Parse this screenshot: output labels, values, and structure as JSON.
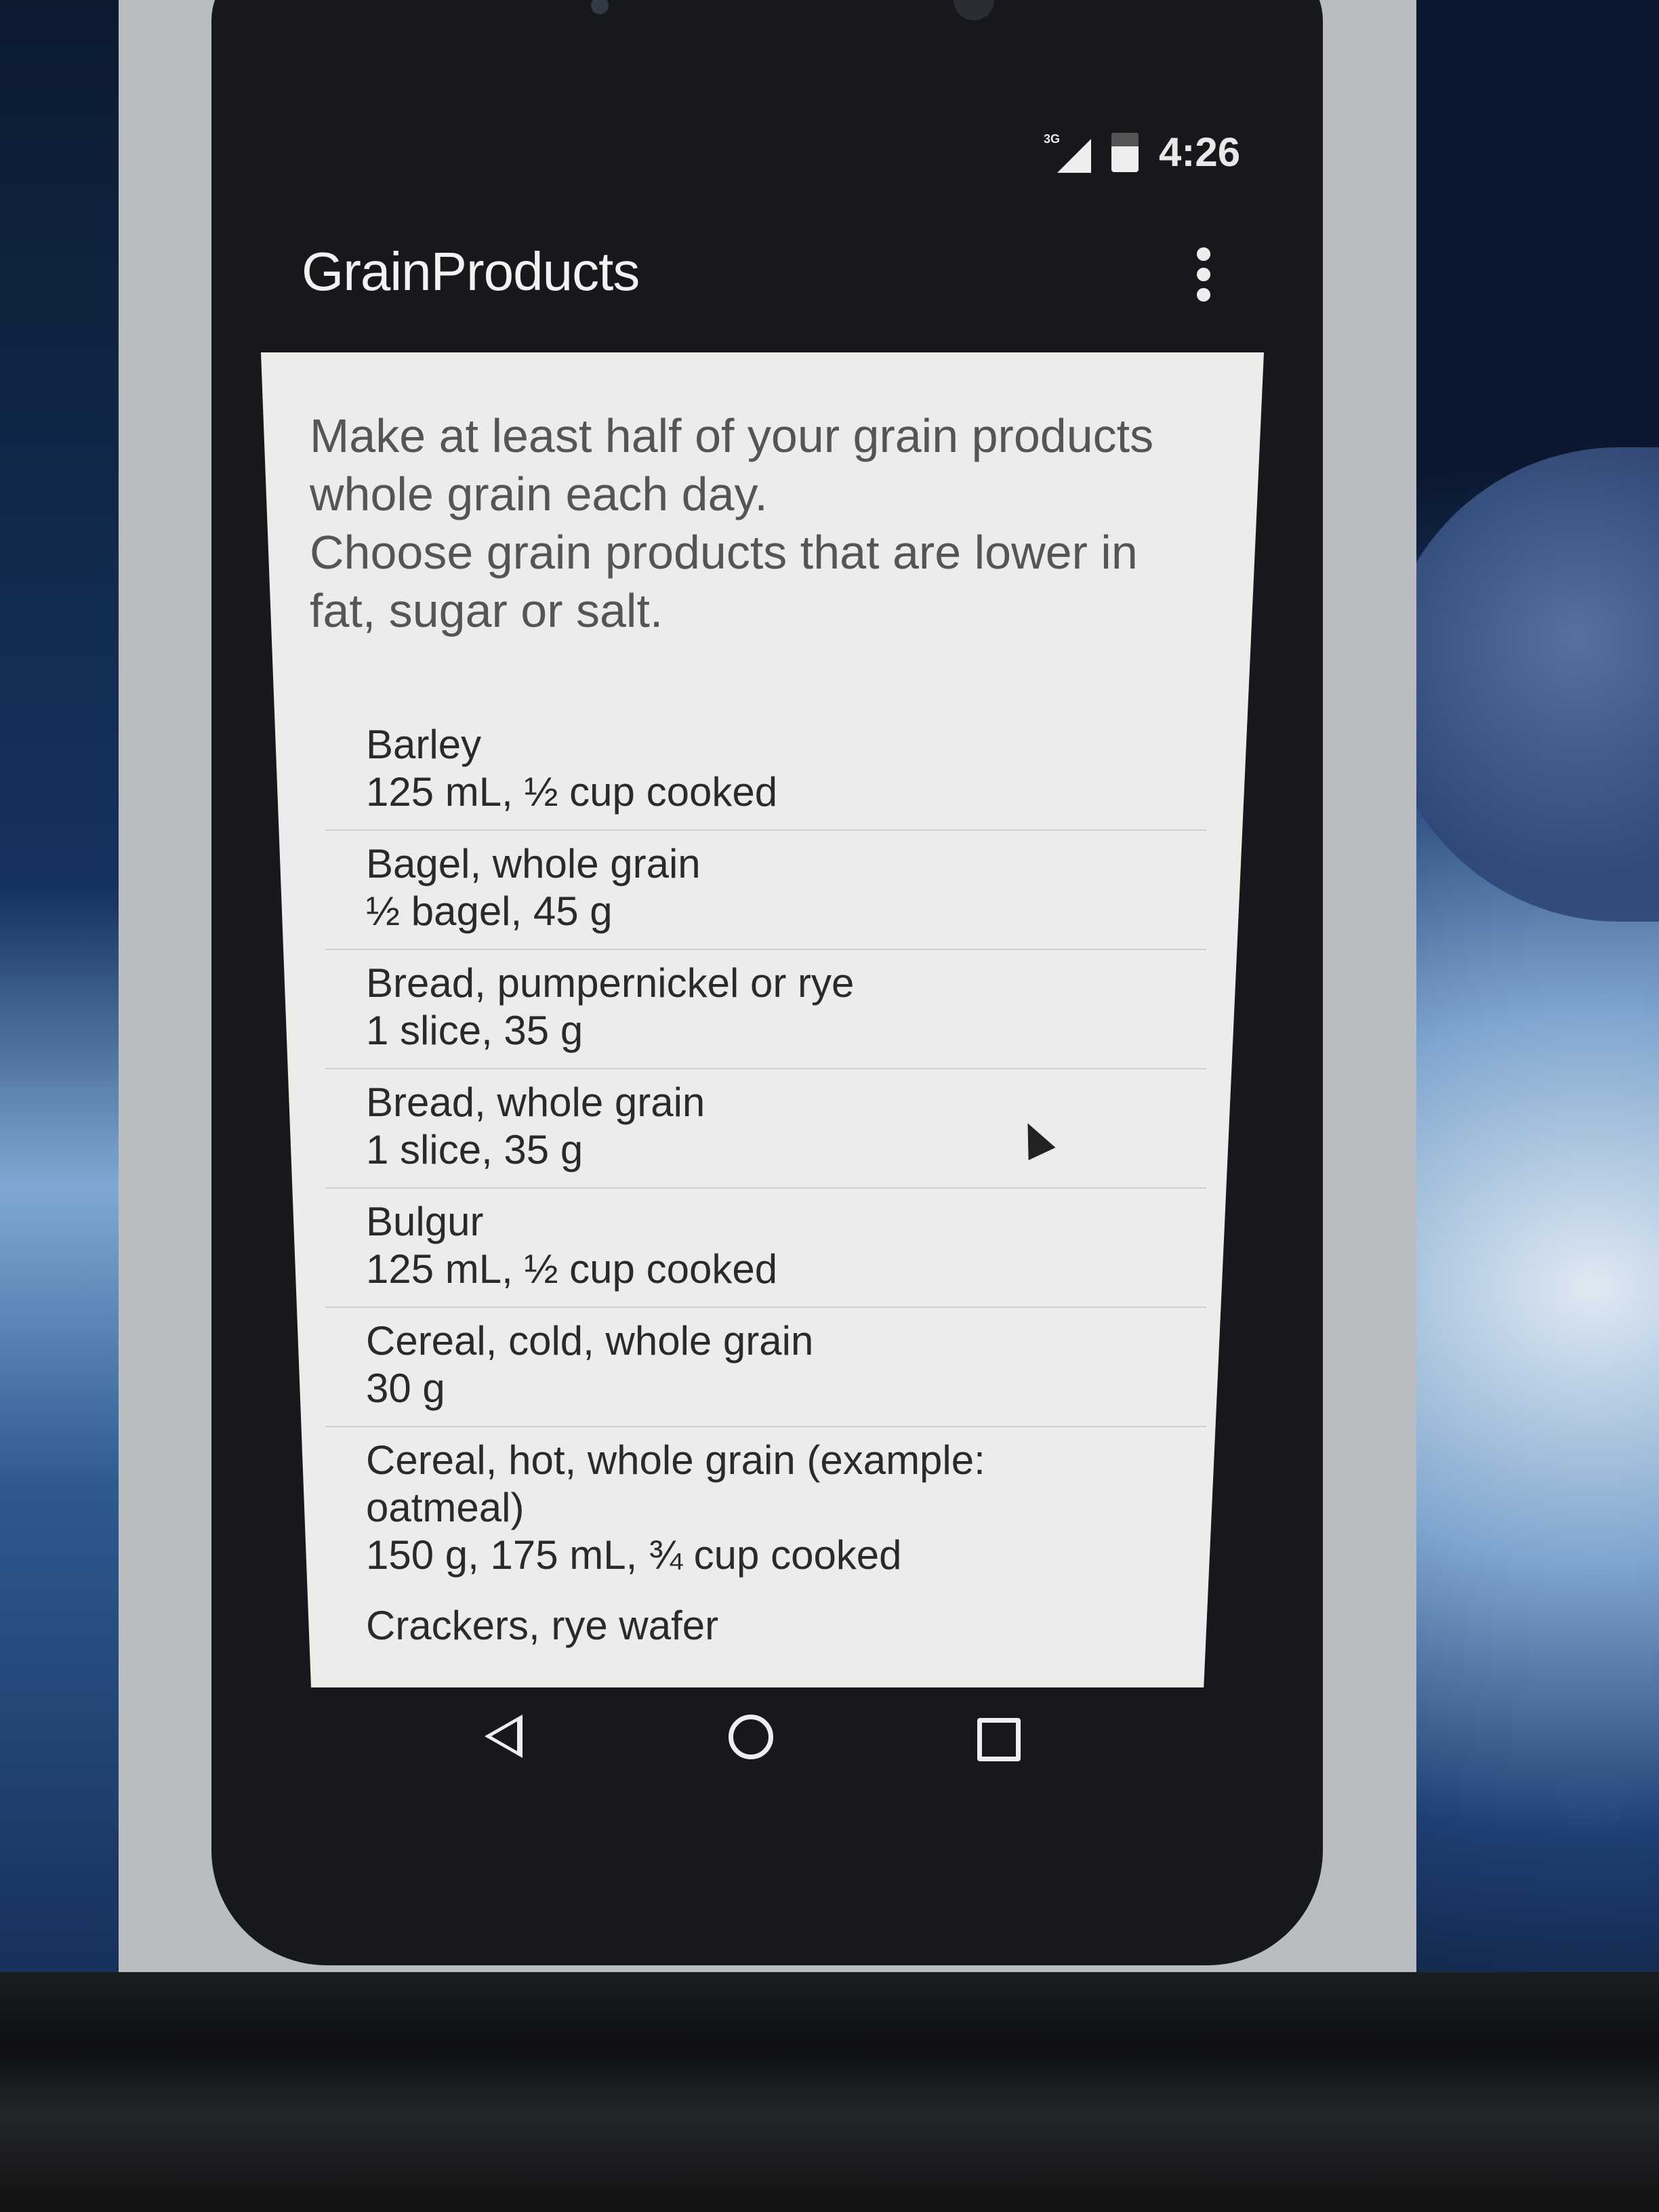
{
  "status_bar": {
    "network": "3G",
    "time": "4:26"
  },
  "app_bar": {
    "title": "GrainProducts",
    "overflow_icon": "more-vert-icon"
  },
  "intro": {
    "line1": "Make at least half of your grain products whole grain each day.",
    "line2": "Choose grain products that are lower in fat, sugar or salt."
  },
  "items": [
    {
      "name": "Barley",
      "serving": "125 mL, ½ cup cooked"
    },
    {
      "name": "Bagel, whole grain",
      "serving": "½ bagel, 45 g"
    },
    {
      "name": "Bread, pumpernickel or rye",
      "serving": "1 slice, 35 g"
    },
    {
      "name": "Bread, whole grain",
      "serving": "1 slice, 35 g"
    },
    {
      "name": "Bulgur",
      "serving": "125 mL, ½ cup cooked"
    },
    {
      "name": "Cereal, cold, whole grain",
      "serving": "30 g"
    },
    {
      "name": "Cereal, hot, whole grain (example: oatmeal)",
      "serving": "150 g, 175 mL, ¾ cup cooked"
    },
    {
      "name": "Crackers, rye wafer",
      "serving": ""
    }
  ],
  "nav": {
    "back": "back-icon",
    "home": "home-icon",
    "recents": "recents-icon"
  }
}
